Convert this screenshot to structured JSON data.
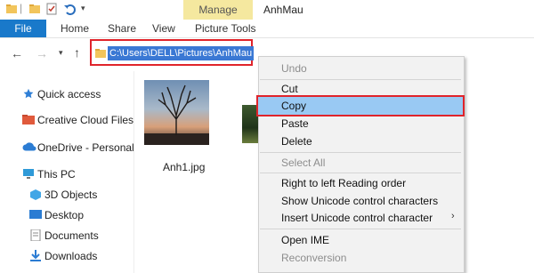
{
  "window": {
    "title": "AnhMau",
    "contextual_tab_group": "Manage"
  },
  "ribbon_tabs": [
    "File",
    "Home",
    "Share",
    "View",
    "Picture Tools"
  ],
  "address_bar": {
    "path": "C:\\Users\\DELL\\Pictures\\AnhMau"
  },
  "nav_pane": {
    "items": [
      {
        "label": "Quick access"
      },
      {
        "label": "Creative Cloud Files"
      },
      {
        "label": "OneDrive - Personal"
      },
      {
        "label": "This PC"
      },
      {
        "label": "3D Objects"
      },
      {
        "label": "Desktop"
      },
      {
        "label": "Documents"
      },
      {
        "label": "Downloads"
      }
    ]
  },
  "files": [
    {
      "name": "Anh1.jpg"
    }
  ],
  "context_menu": {
    "items": [
      {
        "label": "Undo",
        "enabled": false
      },
      {
        "label": "Cut",
        "enabled": true
      },
      {
        "label": "Copy",
        "enabled": true,
        "highlighted": true
      },
      {
        "label": "Paste",
        "enabled": true
      },
      {
        "label": "Delete",
        "enabled": true
      },
      {
        "label": "Select All",
        "enabled": false
      },
      {
        "label": "Right to left Reading order",
        "enabled": true
      },
      {
        "label": "Show Unicode control characters",
        "enabled": true
      },
      {
        "label": "Insert Unicode control character",
        "enabled": true,
        "has_submenu": true
      },
      {
        "label": "Open IME",
        "enabled": true
      },
      {
        "label": "Reconversion",
        "enabled": false
      }
    ]
  },
  "colors": {
    "accent": "#1979ca",
    "highlight_border": "#e0242b",
    "selection": "#3a78d4",
    "menu_hover": "#99c9f3",
    "manage_tab": "#f5e89f"
  }
}
